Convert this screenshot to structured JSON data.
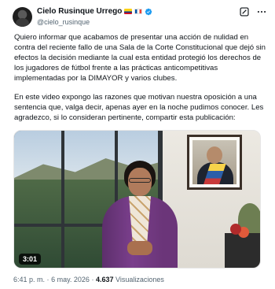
{
  "author": {
    "name": "Cielo Rusinque Urrego",
    "handle": "@cielo_rusinque",
    "flags": [
      "colombia-flag-icon",
      "france-flag-icon"
    ],
    "verified_icon": "verified-badge-icon"
  },
  "header_actions": [
    "grok-icon",
    "more-options-icon"
  ],
  "tweet": {
    "paragraph_1": "Quiero informar que acabamos de presentar una acción de nulidad en contra del reciente fallo de una Sala de la Corte Constitucional que dejó sin efectos la decisión mediante la cual esta entidad protegió los derechos de los jugadores de fútbol frente a las prácticas anticompetitivas implementadas por la DIMAYOR y varios clubes.",
    "paragraph_2": "En este video expongo las razones que motivan nuestra oposición a una sentencia que, valga decir, apenas ayer en la noche pudimos conocer. Les agradezco, si lo consideran pertinente, compartir esta publicación:"
  },
  "video": {
    "duration": "3:01"
  },
  "meta": {
    "time": "6:41 p. m.",
    "separator": "·",
    "date": "6 may. 2026",
    "views_count": "4.637",
    "views_label": "Visualizaciones"
  },
  "colors": {
    "text_primary": "#0f1419",
    "text_secondary": "#536471",
    "verified_blue": "#1d9bf0"
  }
}
